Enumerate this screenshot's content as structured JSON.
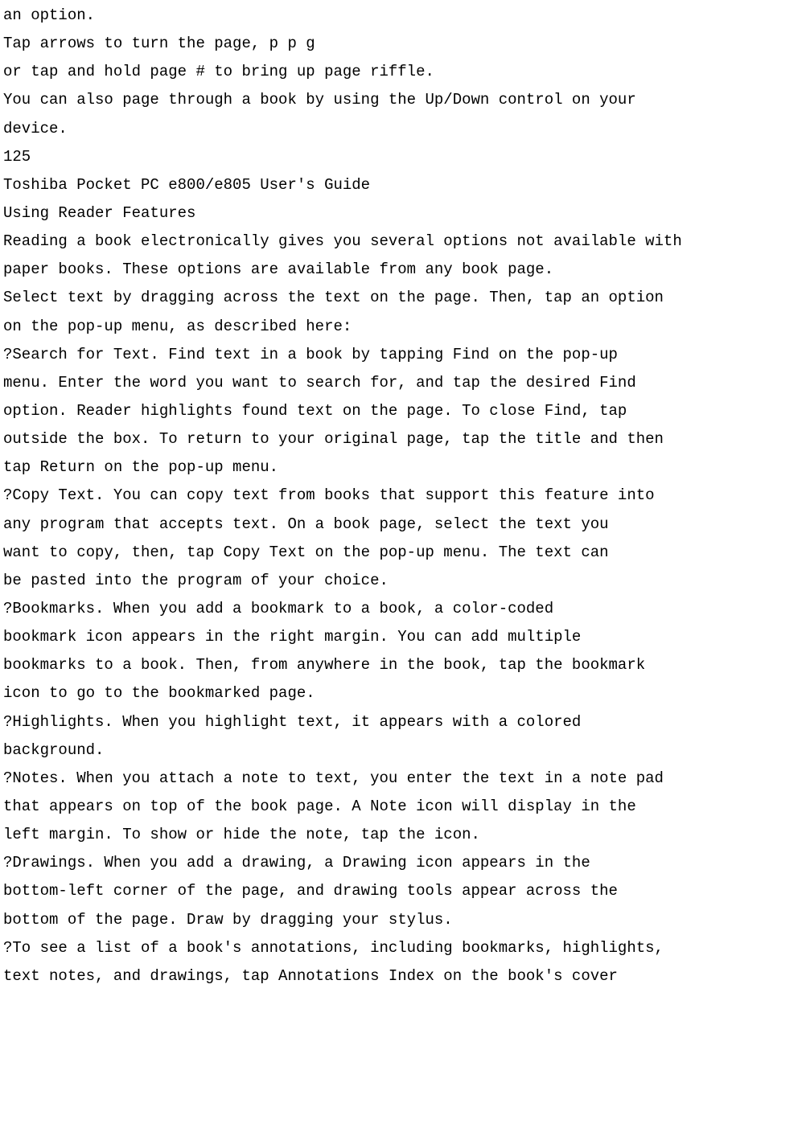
{
  "lines": [
    "an option.",
    "Tap arrows to turn the page, p p g",
    "or tap and hold page # to bring up page riffle.",
    "You can also page through a book by using the Up/Down control on your",
    "device.",
    "125",
    "Toshiba Pocket PC e800/e805 User's Guide",
    "Using Reader Features",
    "Reading a book electronically gives you several options not available with",
    "paper books. These options are available from any book page.",
    "Select text by dragging across the text on the page. Then, tap an option",
    "on the pop-up menu, as described here:",
    "?Search for Text. Find text in a book by tapping Find on the pop-up",
    "menu. Enter the word you want to search for, and tap the desired Find",
    "option. Reader highlights found text on the page. To close Find, tap",
    "outside the box. To return to your original page, tap the title and then",
    "tap Return on the pop-up menu.",
    "?Copy Text. You can copy text from books that support this feature into",
    "any program that accepts text. On a book page, select the text you",
    "want to copy, then, tap Copy Text on the pop-up menu. The text can",
    "be pasted into the program of your choice.",
    "?Bookmarks. When you add a bookmark to a book, a color-coded",
    "bookmark icon appears in the right margin. You can add multiple",
    "bookmarks to a book. Then, from anywhere in the book, tap the bookmark",
    "icon to go to the bookmarked page.",
    "?Highlights. When you highlight text, it appears with a colored",
    "background.",
    "?Notes. When you attach a note to text, you enter the text in a note pad",
    "that appears on top of the book page. A Note icon will display in the",
    "left margin. To show or hide the note, tap the icon.",
    "?Drawings. When you add a drawing, a Drawing icon appears in the",
    "bottom-left corner of the page, and drawing tools appear across the",
    "bottom of the page. Draw by dragging your stylus.",
    "?To see a list of a book's annotations, including bookmarks, highlights,",
    "text notes, and drawings, tap Annotations Index on the book's cover"
  ]
}
